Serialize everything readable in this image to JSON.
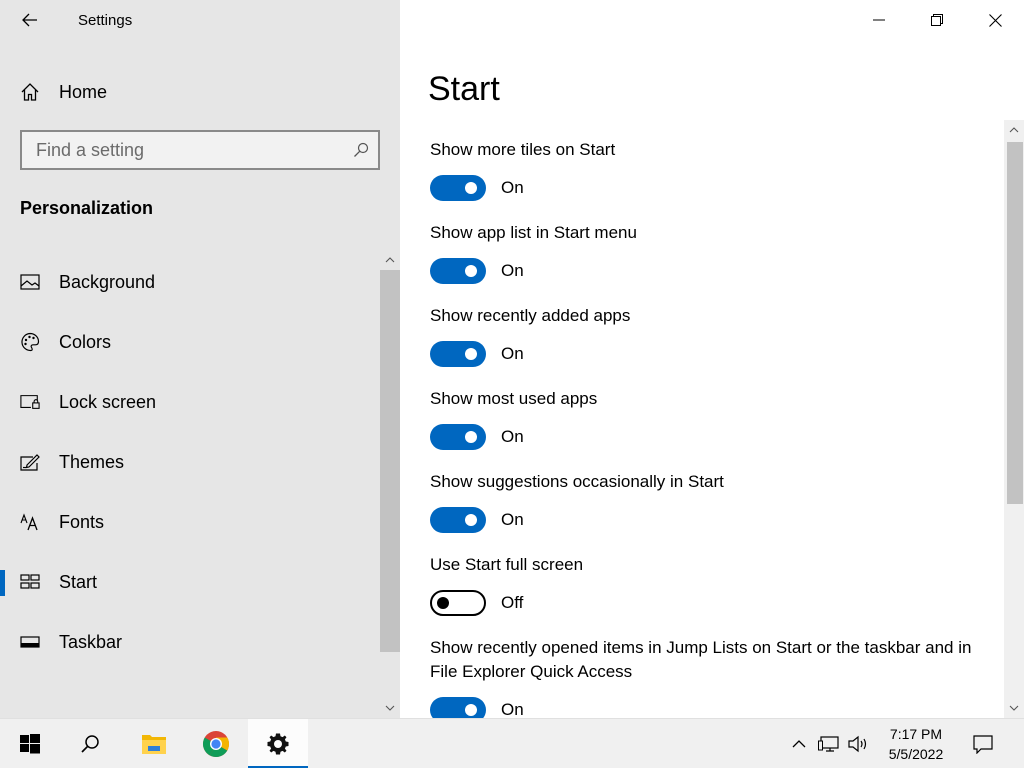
{
  "window": {
    "title": "Settings",
    "controls": {
      "minimize": "minimize",
      "restore": "restore",
      "close": "close"
    }
  },
  "sidebar": {
    "home_label": "Home",
    "search": {
      "placeholder": "Find a setting"
    },
    "section_heading": "Personalization",
    "items": [
      {
        "label": "Background",
        "icon": "picture-icon"
      },
      {
        "label": "Colors",
        "icon": "palette-icon"
      },
      {
        "label": "Lock screen",
        "icon": "lock-screen-icon"
      },
      {
        "label": "Themes",
        "icon": "themes-icon"
      },
      {
        "label": "Fonts",
        "icon": "fonts-icon"
      },
      {
        "label": "Start",
        "icon": "start-icon",
        "selected": true
      },
      {
        "label": "Taskbar",
        "icon": "taskbar-icon"
      }
    ]
  },
  "main": {
    "page_title": "Start",
    "settings": [
      {
        "label": "Show more tiles on Start",
        "state": "On"
      },
      {
        "label": "Show app list in Start menu",
        "state": "On"
      },
      {
        "label": "Show recently added apps",
        "state": "On"
      },
      {
        "label": "Show most used apps",
        "state": "On"
      },
      {
        "label": "Show suggestions occasionally in Start",
        "state": "On"
      },
      {
        "label": "Use Start full screen",
        "state": "Off"
      },
      {
        "label": "Show recently opened items in Jump Lists on Start or the taskbar and in File Explorer Quick Access",
        "state": "On"
      }
    ]
  },
  "taskbar": {
    "apps": [
      "start-button",
      "search-button",
      "file-explorer",
      "chrome",
      "settings"
    ],
    "clock": {
      "time": "7:17 PM",
      "date": "5/5/2022"
    }
  },
  "colors": {
    "accent": "#0067c0",
    "sidebar_bg": "#e6e6e6",
    "taskbar_bg": "#f0f0f0"
  }
}
